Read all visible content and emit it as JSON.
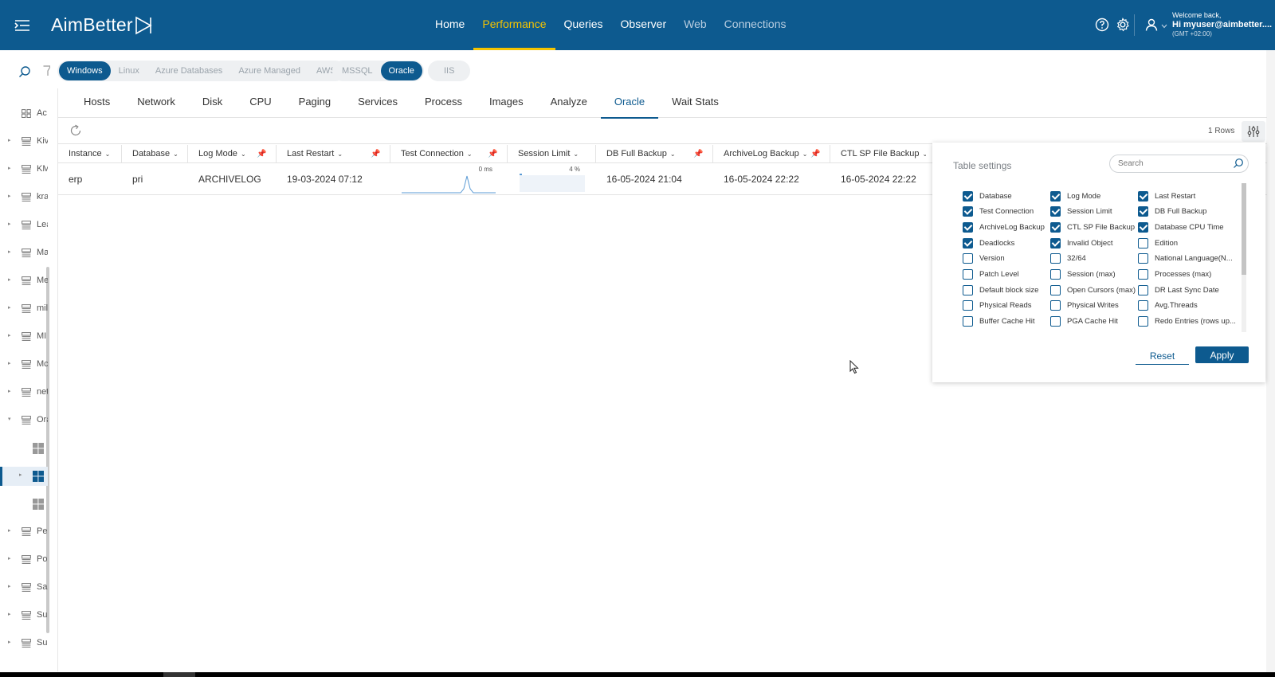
{
  "header": {
    "brand": "AimBetter",
    "nav": [
      {
        "label": "Home",
        "state": "normal"
      },
      {
        "label": "Performance",
        "state": "active"
      },
      {
        "label": "Queries",
        "state": "normal"
      },
      {
        "label": "Observer",
        "state": "normal"
      },
      {
        "label": "Web",
        "state": "dim"
      },
      {
        "label": "Connections",
        "state": "dim"
      }
    ],
    "welcome_line1": "Welcome back,",
    "welcome_line2": "Hi myuser@aimbetter....",
    "welcome_line3": "(GMT +02:00)"
  },
  "sidebar": {
    "items": [
      {
        "label": "Ac",
        "icon": "grid-icon"
      },
      {
        "label": "Kiv",
        "icon": "database-icon"
      },
      {
        "label": "KM",
        "icon": "database-icon"
      },
      {
        "label": "kra",
        "icon": "database-icon"
      },
      {
        "label": "Lea",
        "icon": "database-icon"
      },
      {
        "label": "Ma",
        "icon": "database-icon"
      },
      {
        "label": "Me",
        "icon": "database-icon"
      },
      {
        "label": "mil",
        "icon": "database-icon"
      },
      {
        "label": "MI",
        "icon": "database-icon"
      },
      {
        "label": "Mc",
        "icon": "database-icon"
      },
      {
        "label": "net",
        "icon": "database-icon"
      },
      {
        "label": "Ora",
        "icon": "database-icon"
      },
      {
        "label": "",
        "icon": "windows-icon"
      },
      {
        "label": "",
        "icon": "windows-icon"
      },
      {
        "label": "",
        "icon": "windows-icon"
      },
      {
        "label": "Pe",
        "icon": "database-icon"
      },
      {
        "label": "Po",
        "icon": "database-icon"
      },
      {
        "label": "Sa",
        "icon": "database-icon"
      },
      {
        "label": "Su",
        "icon": "database-icon"
      },
      {
        "label": "Su",
        "icon": "database-icon"
      }
    ]
  },
  "filters": {
    "platform": [
      "Windows",
      "Linux",
      "Azure Databases",
      "Azure Managed",
      "AWS"
    ],
    "platform_selected": "Windows",
    "db_type": [
      "MSSQL",
      "Oracle"
    ],
    "db_type_selected": "Oracle",
    "web": [
      "IIS"
    ]
  },
  "tabs": [
    "Hosts",
    "Network",
    "Disk",
    "CPU",
    "Paging",
    "Services",
    "Process",
    "Images",
    "Analyze",
    "Oracle",
    "Wait Stats"
  ],
  "active_tab": "Oracle",
  "toolbar": {
    "rows_count": "1 Rows"
  },
  "table": {
    "columns": [
      "Instance",
      "Database",
      "Log Mode",
      "Last Restart",
      "Test Connection",
      "Session Limit",
      "DB Full Backup",
      "ArchiveLog Backup",
      "CTL SP File Backup"
    ],
    "row": {
      "instance": "erp",
      "database": "pri",
      "log_mode": "ARCHIVELOG",
      "last_restart": "19-03-2024 07:12",
      "test_connection_label": "0 ms",
      "session_limit_label": "4 %",
      "session_limit_pct": 4,
      "db_full_backup": "16-05-2024 21:04",
      "archivelog_backup": "16-05-2024 22:22",
      "ctl_sp_file_backup": "16-05-2024 22:22"
    }
  },
  "table_settings": {
    "title": "Table settings",
    "search_placeholder": "Search",
    "options": [
      {
        "label": "Database",
        "checked": true
      },
      {
        "label": "Log Mode",
        "checked": true
      },
      {
        "label": "Last Restart",
        "checked": true
      },
      {
        "label": "Test Connection",
        "checked": true
      },
      {
        "label": "Session Limit",
        "checked": true
      },
      {
        "label": "DB Full Backup",
        "checked": true
      },
      {
        "label": "ArchiveLog Backup",
        "checked": true
      },
      {
        "label": "CTL SP File Backup",
        "checked": true
      },
      {
        "label": "Database CPU Time",
        "checked": true
      },
      {
        "label": "Deadlocks",
        "checked": true
      },
      {
        "label": "Invalid Object",
        "checked": true
      },
      {
        "label": "Edition",
        "checked": false
      },
      {
        "label": "Version",
        "checked": false
      },
      {
        "label": "32/64",
        "checked": false
      },
      {
        "label": "National Language(N...",
        "checked": false
      },
      {
        "label": "Patch Level",
        "checked": false
      },
      {
        "label": "Session (max)",
        "checked": false
      },
      {
        "label": "Processes (max)",
        "checked": false
      },
      {
        "label": "Default block size",
        "checked": false
      },
      {
        "label": "Open Cursors (max)",
        "checked": false
      },
      {
        "label": "DR Last Sync Date",
        "checked": false
      },
      {
        "label": "Physical Reads",
        "checked": false
      },
      {
        "label": "Physical Writes",
        "checked": false
      },
      {
        "label": "Avg.Threads",
        "checked": false
      },
      {
        "label": "Buffer Cache Hit",
        "checked": false
      },
      {
        "label": "PGA Cache Hit",
        "checked": false
      },
      {
        "label": "Redo Entries (rows up...",
        "checked": false
      }
    ],
    "reset_label": "Reset",
    "apply_label": "Apply"
  },
  "colors": {
    "brand": "#0d5a8f",
    "accent": "#f5c400"
  }
}
